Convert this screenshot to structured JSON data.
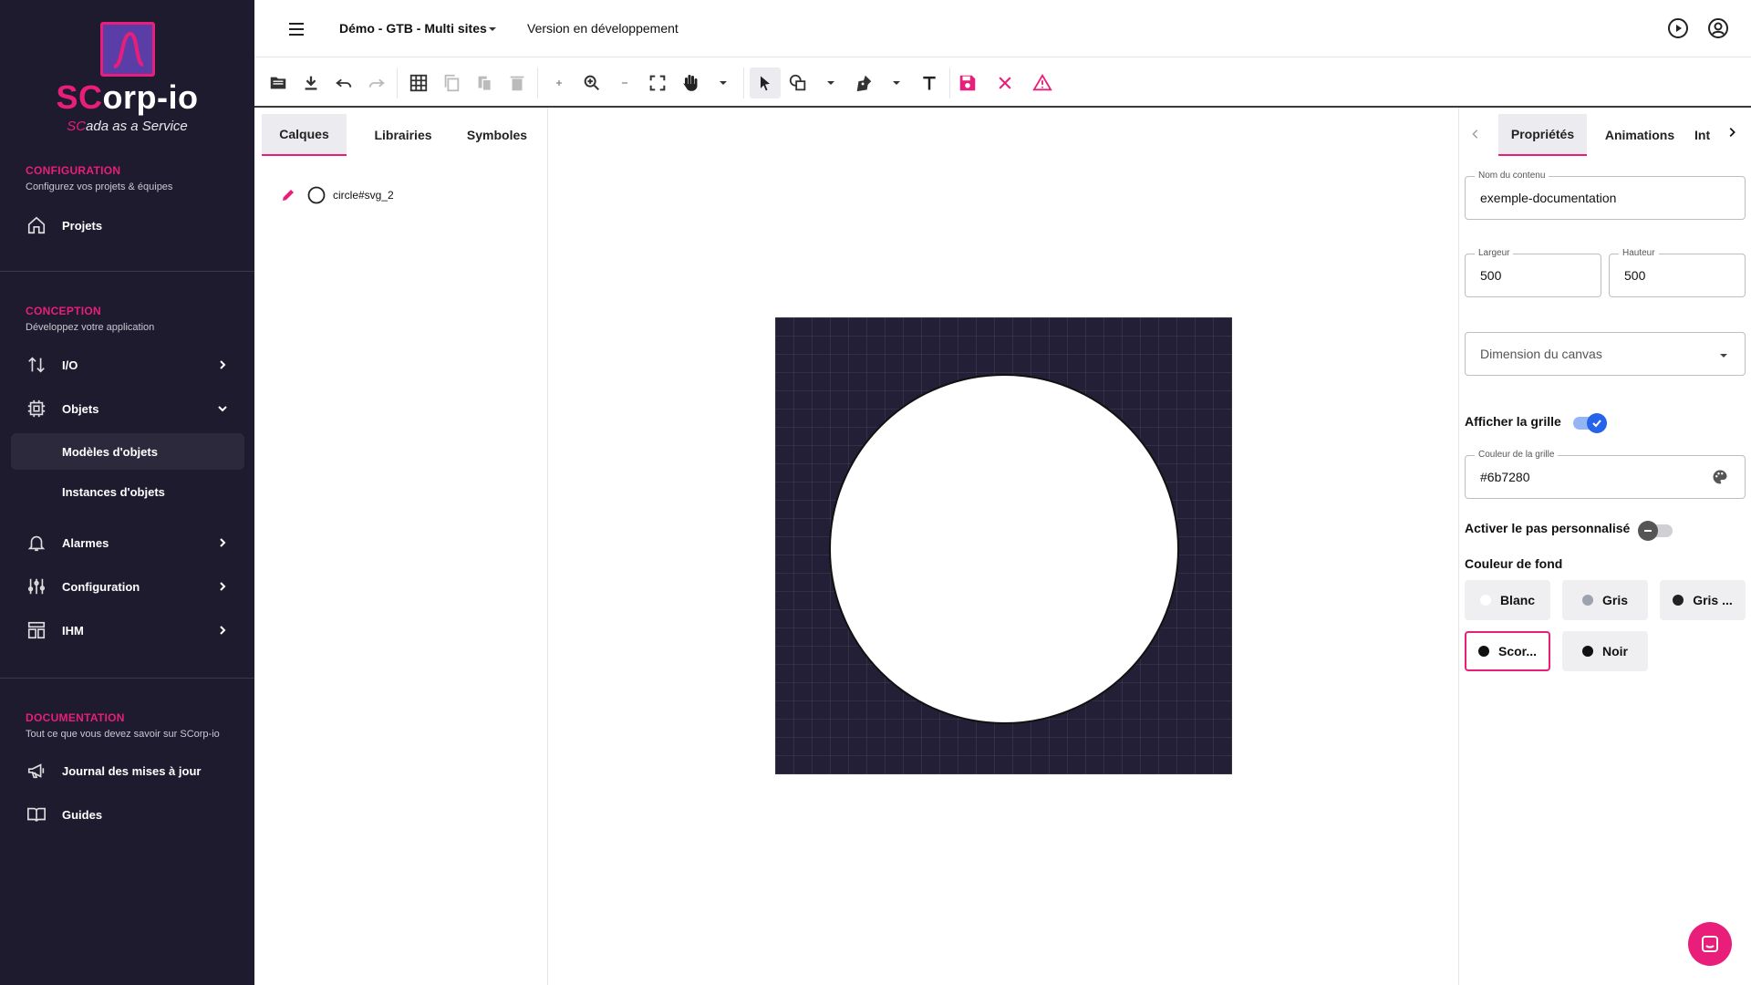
{
  "app": {
    "brand_prefix": "SC",
    "brand_rest": "orp-io",
    "tagline_prefix": "SC",
    "tagline_rest": "ada as a Service"
  },
  "sidebar": {
    "sections": [
      {
        "title": "CONFIGURATION",
        "subtitle": "Configurez vos projets & équipes"
      },
      {
        "title": "CONCEPTION",
        "subtitle": "Développez votre application"
      },
      {
        "title": "DOCUMENTATION",
        "subtitle": "Tout ce que vous devez savoir sur SCorp-io"
      }
    ],
    "items": [
      {
        "label": "Projets",
        "icon": "home-icon"
      },
      {
        "label": "I/O",
        "icon": "arrows-up-down-icon"
      },
      {
        "label": "Objets",
        "icon": "chip-icon"
      },
      {
        "label": "Modèles d'objets"
      },
      {
        "label": "Instances d'objets"
      },
      {
        "label": "Alarmes",
        "icon": "bell-icon"
      },
      {
        "label": "Configuration",
        "icon": "sliders-icon"
      },
      {
        "label": "IHM",
        "icon": "layout-icon"
      },
      {
        "label": "Journal des mises à jour",
        "icon": "megaphone-icon"
      },
      {
        "label": "Guides",
        "icon": "book-icon"
      }
    ]
  },
  "topbar": {
    "project": "Démo - GTB - Multi sites",
    "version": "Version en développement"
  },
  "left_panel": {
    "tabs": [
      "Calques",
      "Librairies",
      "Symboles"
    ],
    "active_tab": "Calques",
    "layers": [
      {
        "label": "circle#svg_2"
      }
    ]
  },
  "canvas": {
    "width": 500,
    "height": 500,
    "background": "#231f36",
    "shape_fill": "#ffffff"
  },
  "right_panel": {
    "tabs": [
      "Propriétés",
      "Animations",
      "Int"
    ],
    "active_tab": "Propriétés",
    "content_name": {
      "label": "Nom du contenu",
      "value": "exemple-documentation"
    },
    "width": {
      "label": "Largeur",
      "value": "500"
    },
    "height": {
      "label": "Hauteur",
      "value": "500"
    },
    "canvas_dimension": {
      "placeholder": "Dimension du canvas"
    },
    "show_grid": {
      "label": "Afficher la grille",
      "on": true
    },
    "grid_color": {
      "label": "Couleur de la grille",
      "value": "#6b7280"
    },
    "custom_step": {
      "label": "Activer le pas personnalisé",
      "on": false
    },
    "bg_color": {
      "label": "Couleur de fond",
      "options": [
        {
          "label": "Blanc",
          "color": "#ffffff"
        },
        {
          "label": "Gris",
          "color": "#9ca3af"
        },
        {
          "label": "Gris ...",
          "color": "#222222"
        },
        {
          "label": "Scor...",
          "color": "#111111",
          "selected": true
        },
        {
          "label": "Noir",
          "color": "#111111"
        }
      ]
    }
  },
  "colors": {
    "accent": "#e91e7a",
    "sidebar_bg": "#1e1b2e",
    "toggle_on": "#2563eb"
  }
}
